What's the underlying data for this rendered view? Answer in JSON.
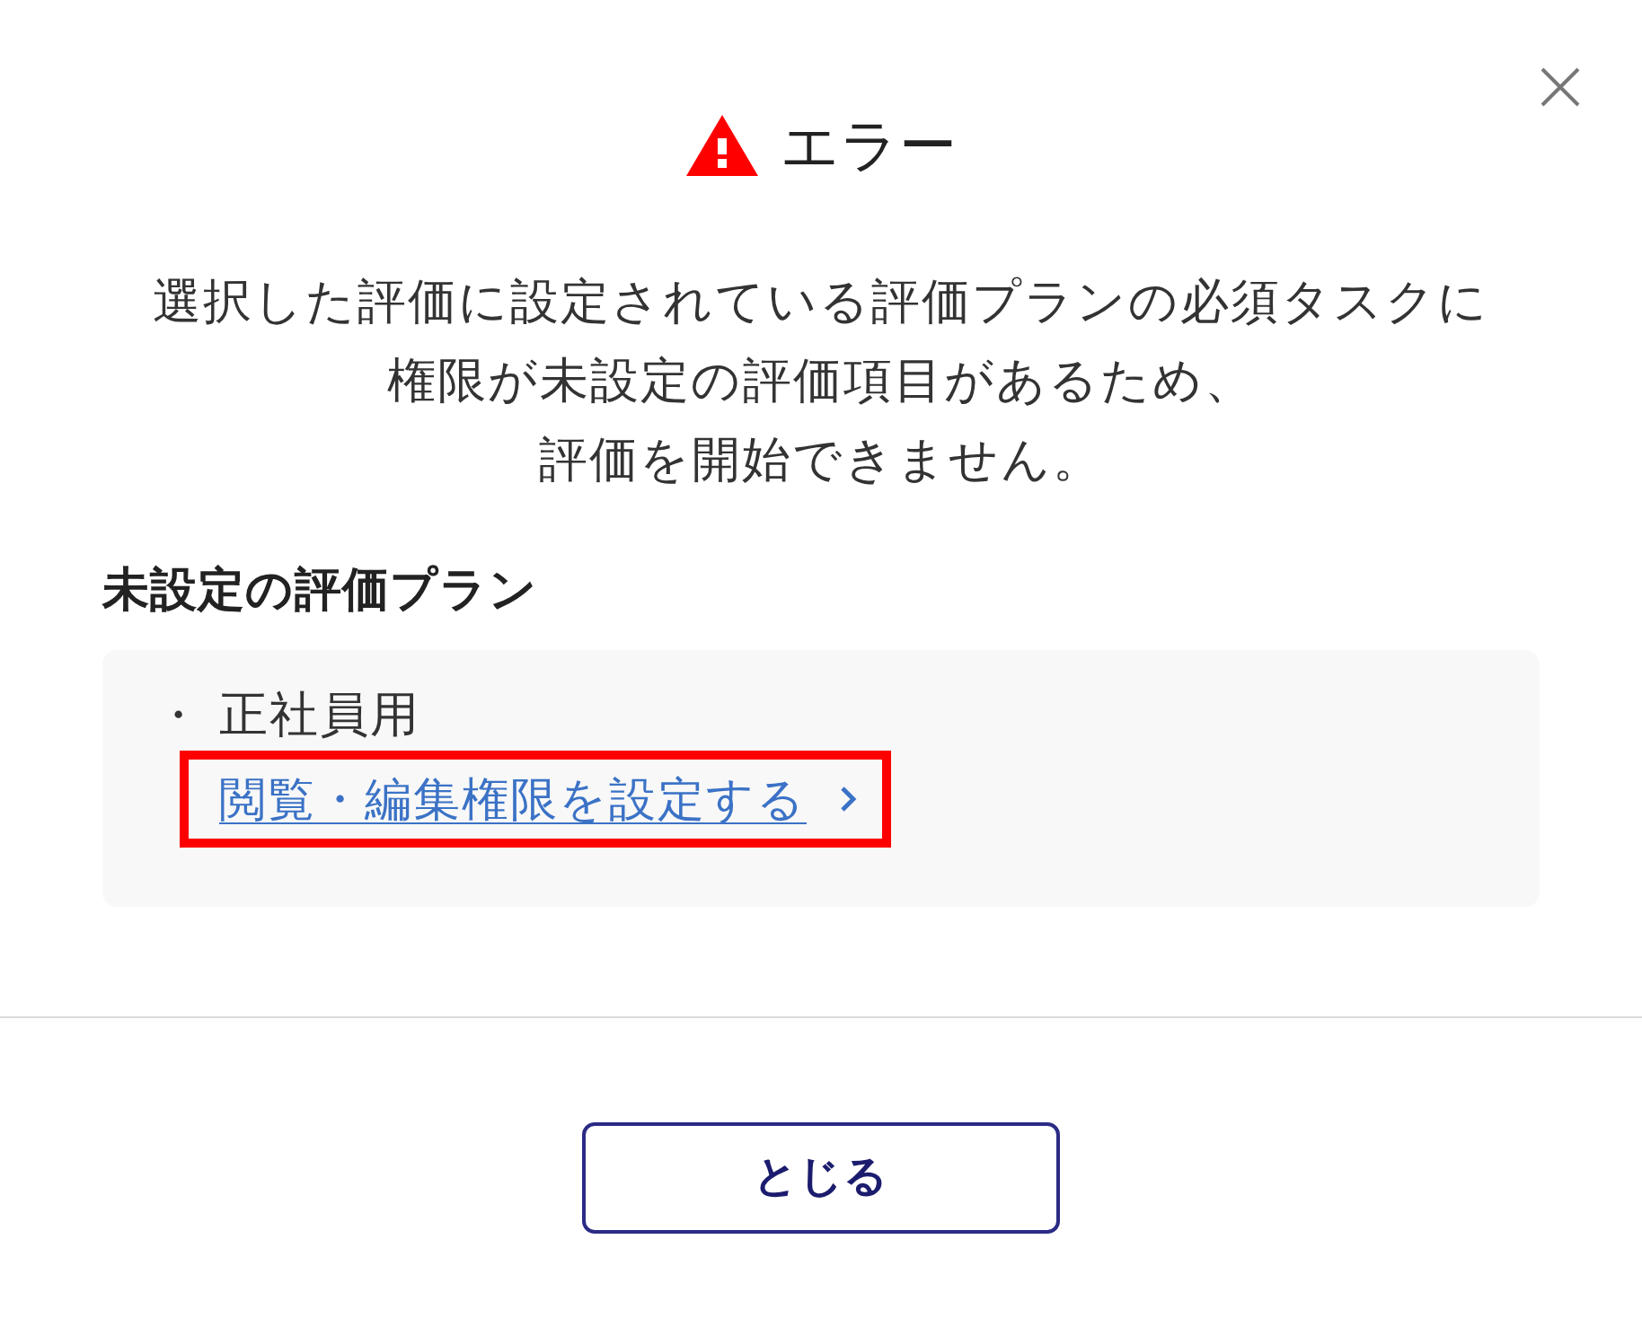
{
  "dialog": {
    "title": "エラー",
    "message": [
      "選択した評価に設定されている評価プランの必須タスクに",
      "権限が未設定の評価項目があるため、",
      "評価を開始できません。"
    ],
    "section_heading": "未設定の評価プラン",
    "plans": [
      {
        "bullet": "・",
        "name": "正社員用",
        "link": {
          "label": "閲覧・編集権限を設定する",
          "highlighted": true
        }
      }
    ],
    "buttons": [
      {
        "label": "とじる"
      }
    ]
  }
}
